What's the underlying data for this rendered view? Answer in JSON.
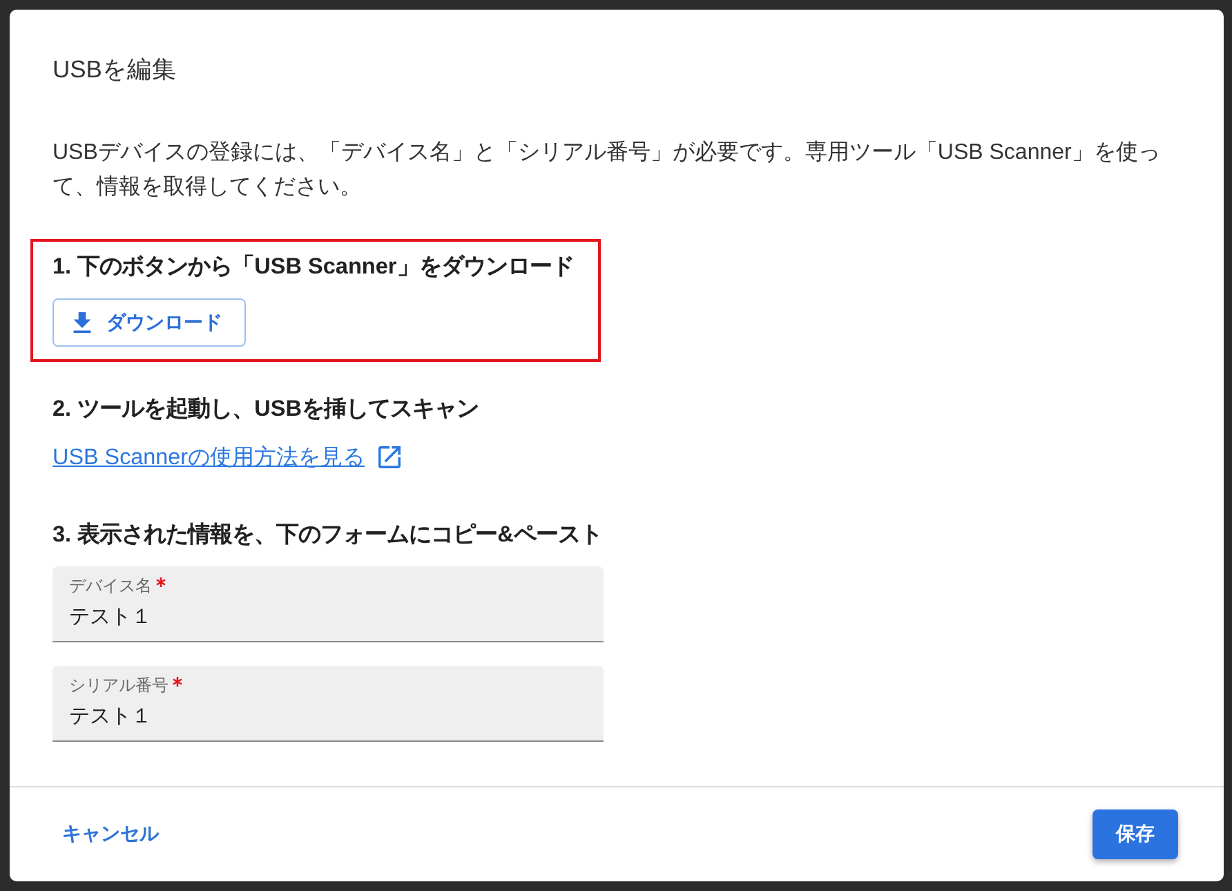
{
  "dialog": {
    "title": "USBを編集",
    "description": "USBデバイスの登録には、「デバイス名」と「シリアル番号」が必要です。専用ツール「USB Scanner」を使って、情報を取得してください。"
  },
  "steps": [
    {
      "kind": "download",
      "heading": "1. 下のボタンから「USB Scanner」をダウンロード",
      "highlighted": true,
      "button": "ダウンロード"
    },
    {
      "kind": "link",
      "heading": "2. ツールを起動し、USBを挿してスキャン",
      "highlighted": false,
      "link": "USB Scannerの使用方法を見る"
    },
    {
      "kind": "form",
      "heading": "3. 表示された情報を、下のフォームにコピー&ペースト",
      "highlighted": false,
      "fields": [
        {
          "label": "デバイス名",
          "required": true,
          "value": "テスト１"
        },
        {
          "label": "シリアル番号",
          "required": true,
          "value": "テスト１"
        }
      ]
    }
  ],
  "footer": {
    "buttons": [
      {
        "kind": "text",
        "label": "キャンセル"
      },
      {
        "kind": "primary",
        "label": "保存"
      }
    ]
  }
}
